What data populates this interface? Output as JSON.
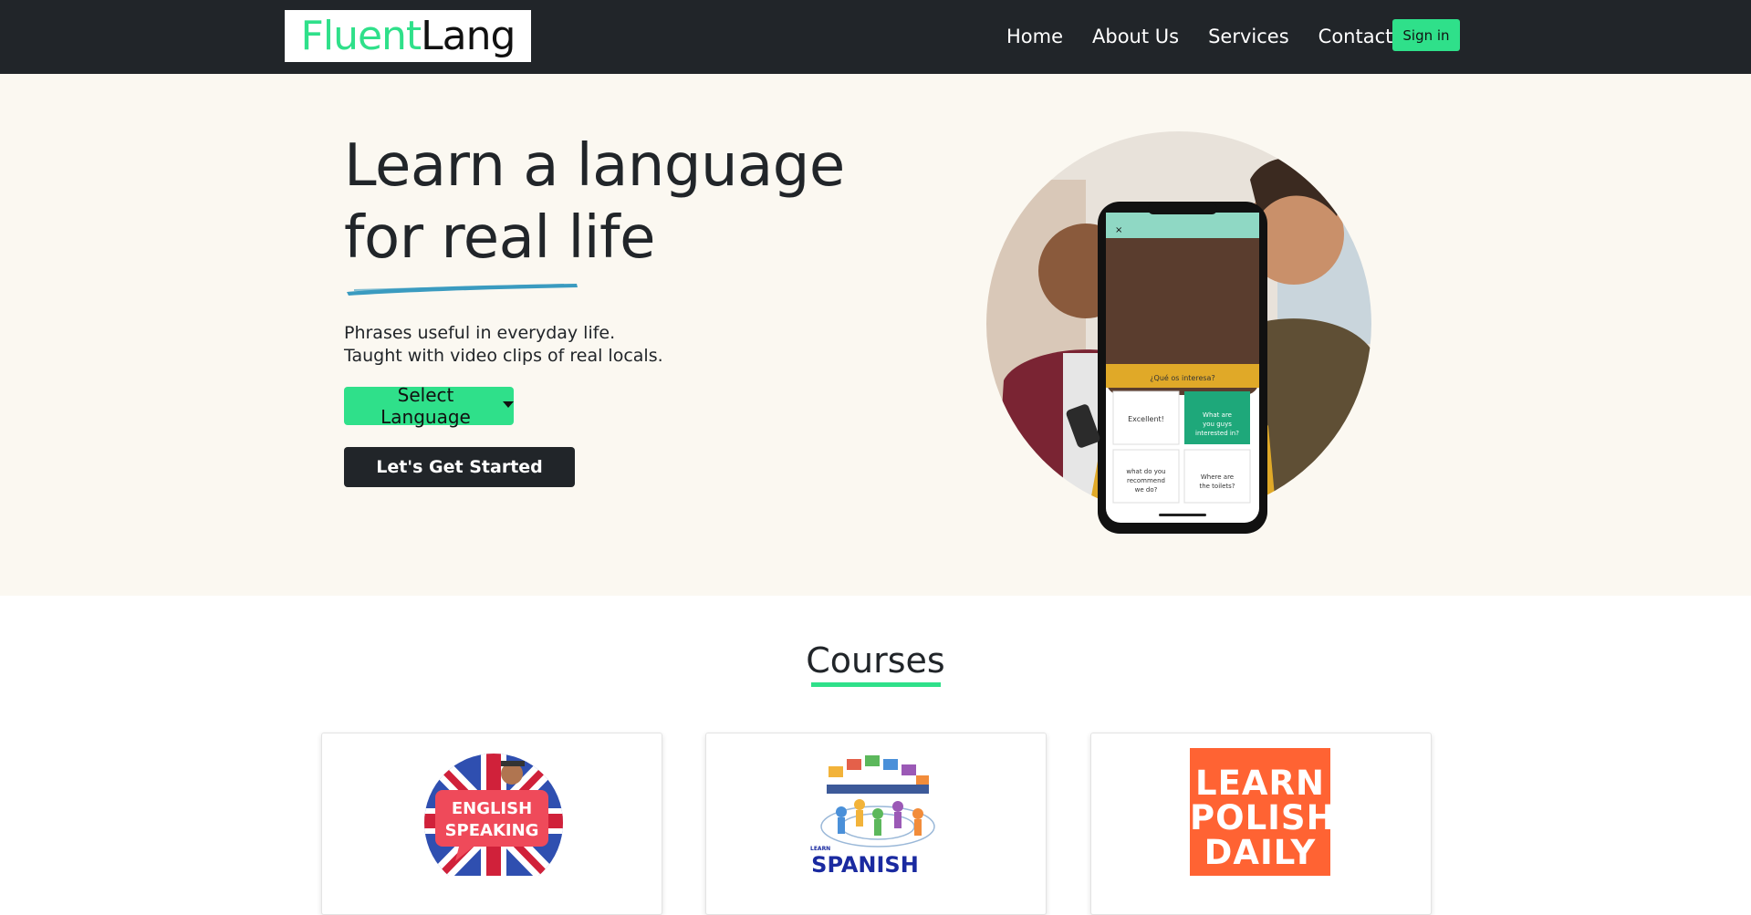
{
  "nav": {
    "logo_part1": "Fluent",
    "logo_part2": "Lang",
    "links": [
      "Home",
      "About Us",
      "Services",
      "Contact"
    ],
    "signin_label": "Sign in"
  },
  "hero": {
    "title_line1": "Learn a language",
    "title_line2": "for real life",
    "sub_line1": "Phrases useful in everyday life.",
    "sub_line2": "Taught with video clips of real locals.",
    "select_label": "Select Language",
    "cta_label": "Let's Get Started",
    "phone": {
      "question": "¿Qué os interesa?",
      "opt1": "Excellent!",
      "opt2": "What are you guys interested in?",
      "opt3": "What do you recommend we do?",
      "opt4": "Where are the toilets?"
    }
  },
  "courses": {
    "title": "Courses",
    "cards": [
      {
        "badge_line1": "ENGLISH",
        "badge_line2": "SPEAKING"
      },
      {
        "badge_small": "LEARN",
        "badge_big": "SPANISH"
      },
      {
        "badge_line1": "LEARN",
        "badge_line2": "POLISH",
        "badge_line3": "DAILY"
      }
    ]
  },
  "colors": {
    "navbar": "#212529",
    "accent_green": "#2fe08a",
    "hero_bg": "#fbf8f1",
    "brush_blue": "#3a9bc0",
    "polish_orange": "#ff6333"
  }
}
